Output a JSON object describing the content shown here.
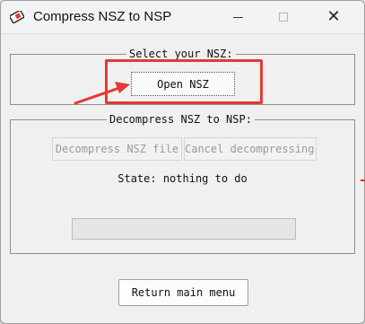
{
  "window": {
    "title": "Compress NSZ to NSP",
    "close_glyph": "✕"
  },
  "select_group": {
    "legend": "Select your NSZ:",
    "open_button": "Open NSZ"
  },
  "decompress_group": {
    "legend": "Decompress NSZ to NSP:",
    "decompress_button": "Decompress NSZ file",
    "cancel_button": "Cancel decompressing",
    "state": "State: nothing to do",
    "progress": 0
  },
  "footer": {
    "return_button": "Return main menu"
  },
  "colors": {
    "annotation": "#e53935",
    "window_bg": "#f0f0f0"
  },
  "icons": [
    "app-icon",
    "minimize-icon",
    "maximize-icon",
    "close-icon",
    "annotation-arrow"
  ]
}
